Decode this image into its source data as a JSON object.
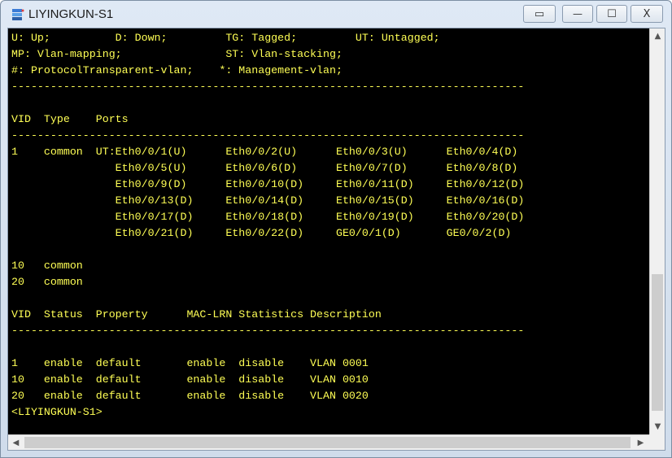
{
  "window": {
    "title": "LIYINGKUN-S1",
    "buttons": {
      "restore": "▭",
      "minimize": "—",
      "maximize": "☐",
      "close": "X"
    }
  },
  "terminal": {
    "lines": [
      "U: Up;          D: Down;         TG: Tagged;         UT: Untagged;",
      "MP: Vlan-mapping;                ST: Vlan-stacking;",
      "#: ProtocolTransparent-vlan;    *: Management-vlan;",
      "-------------------------------------------------------------------------------",
      "",
      "VID  Type    Ports",
      "-------------------------------------------------------------------------------",
      "1    common  UT:Eth0/0/1(U)      Eth0/0/2(U)      Eth0/0/3(U)      Eth0/0/4(D)",
      "                Eth0/0/5(U)      Eth0/0/6(D)      Eth0/0/7(D)      Eth0/0/8(D)",
      "                Eth0/0/9(D)      Eth0/0/10(D)     Eth0/0/11(D)     Eth0/0/12(D)",
      "                Eth0/0/13(D)     Eth0/0/14(D)     Eth0/0/15(D)     Eth0/0/16(D)",
      "                Eth0/0/17(D)     Eth0/0/18(D)     Eth0/0/19(D)     Eth0/0/20(D)",
      "                Eth0/0/21(D)     Eth0/0/22(D)     GE0/0/1(D)       GE0/0/2(D)",
      "",
      "10   common",
      "20   common",
      "",
      "VID  Status  Property      MAC-LRN Statistics Description",
      "-------------------------------------------------------------------------------",
      "",
      "1    enable  default       enable  disable    VLAN 0001",
      "10   enable  default       enable  disable    VLAN 0010",
      "20   enable  default       enable  disable    VLAN 0020",
      "<LIYINGKUN-S1>"
    ]
  },
  "scrollbars": {
    "up": "▲",
    "down": "▼",
    "left": "◀",
    "right": "▶"
  },
  "colors": {
    "terminal_bg": "#000000",
    "terminal_fg": "#ffff55"
  }
}
